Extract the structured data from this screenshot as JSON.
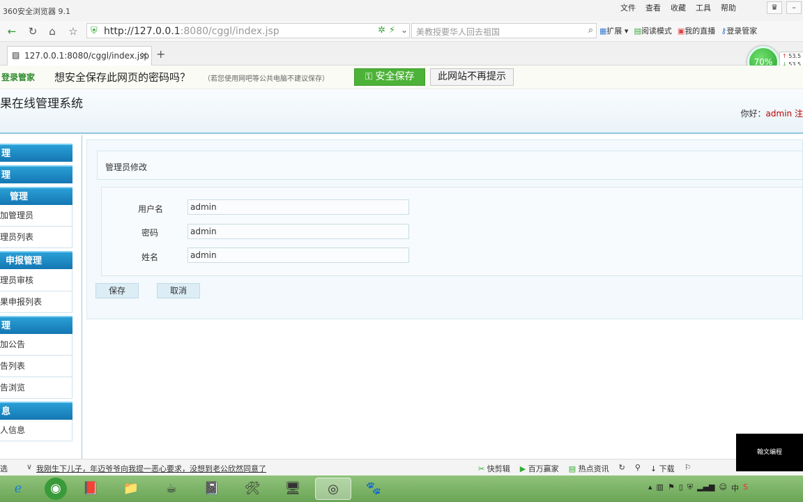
{
  "browser": {
    "title": "360安全浏览器 9.1",
    "menu": [
      "文件",
      "查看",
      "收藏",
      "工具",
      "帮助"
    ],
    "url_host": "http://127.0.0.1",
    "url_rest": ":8080/cggl/index.jsp",
    "search_placeholder": "美教授要华人回去祖国",
    "toolbar": [
      "扩展",
      "阅读模式",
      "我的直播",
      "登录管家"
    ],
    "tab_title": "127.0.0.1:8080/cggl/index.jsp",
    "meter": "70%",
    "speed_up": "53.5",
    "speed_down": "53.5"
  },
  "password_bar": {
    "logo": "登录管家",
    "question": "想安全保存此网页的密码吗？",
    "sub": "（若您使用网吧等公共电脑不建议保存）",
    "save": "安全保存",
    "never": "此网站不再提示"
  },
  "header": {
    "system_title": "果在线管理系统",
    "greeting": "你好：",
    "user": "admin",
    "suffix": "注"
  },
  "sidebar": {
    "sections": [
      {
        "title": "理",
        "items": []
      },
      {
        "title": "理",
        "items": []
      },
      {
        "title": "管理",
        "items": [
          "加管理员",
          "理员列表"
        ]
      },
      {
        "title": "申报管理",
        "items": [
          "理员审核",
          "果申报列表"
        ]
      },
      {
        "title": "理",
        "items": [
          "加公告",
          "告列表",
          "告浏览"
        ]
      },
      {
        "title": "息",
        "items": [
          "人信息"
        ]
      }
    ]
  },
  "form": {
    "panel_title": "管理员修改",
    "username_label": "用户名",
    "username_value": "admin",
    "password_label": "密码",
    "password_value": "admin",
    "name_label": "姓名",
    "name_value": "admin",
    "save": "保存",
    "cancel": "取消"
  },
  "statusbar": {
    "left": "选",
    "news": "我刚生下儿子，年迈爷爷向我提一恶心要求，没想到老公欣然同意了",
    "right": [
      "快剪辑",
      "百万赢家",
      "热点资讯",
      "下载"
    ]
  },
  "logo_text": "翰文编程",
  "tray": [
    "中"
  ]
}
